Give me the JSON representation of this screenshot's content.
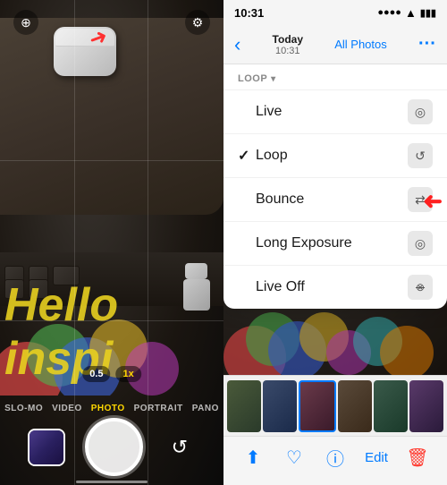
{
  "camera": {
    "icons": {
      "live": "⊕",
      "settings": "⚙"
    },
    "zoom": {
      "options": [
        "0.5",
        "1x"
      ],
      "active": "1x"
    },
    "modes": [
      "SLO-MO",
      "VIDEO",
      "PHOTO",
      "PORTRAIT",
      "PANO"
    ],
    "active_mode": "PHOTO"
  },
  "photos": {
    "status": {
      "time": "10:31"
    },
    "nav": {
      "back_label": "‹",
      "title": "Today",
      "subtitle": "10:31",
      "all_photos": "All Photos",
      "more": "···"
    },
    "dropdown": {
      "header": "LOOP",
      "items": [
        {
          "label": "Live",
          "icon": "◎",
          "checked": false
        },
        {
          "label": "Loop",
          "icon": "↺",
          "checked": true
        },
        {
          "label": "Bounce",
          "icon": "⇄",
          "checked": false
        },
        {
          "label": "Long Exposure",
          "icon": "◎",
          "checked": false
        },
        {
          "label": "Live Off",
          "icon": "⊗",
          "checked": false
        }
      ]
    },
    "toolbar": {
      "share": "↑",
      "heart": "♡",
      "info": "ⓘ",
      "edit": "Edit",
      "trash": "🗑"
    }
  }
}
